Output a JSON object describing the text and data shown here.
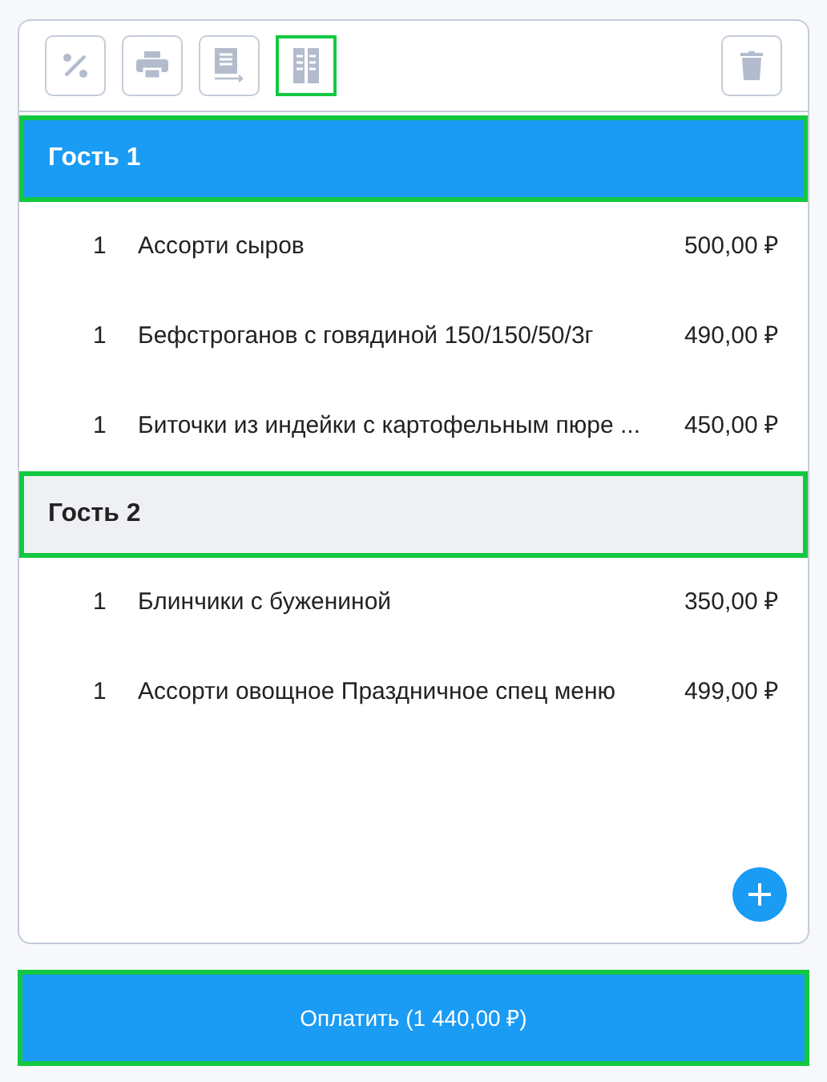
{
  "toolbar": [
    {
      "kind": "percent",
      "highlighted": false
    },
    {
      "kind": "print",
      "highlighted": false
    },
    {
      "kind": "receipt",
      "highlighted": false
    },
    {
      "kind": "split",
      "highlighted": true
    }
  ],
  "guests": [
    {
      "name": "Гость 1",
      "selected": true,
      "items": [
        {
          "qty": "1",
          "name": "Ассорти сыров",
          "price": "500,00 ₽"
        },
        {
          "qty": "1",
          "name": "Бефстроганов с говядиной 150/150/50/3г",
          "price": "490,00 ₽"
        },
        {
          "qty": "1",
          "name": "Биточки из индейки с картофельным пюре ...",
          "price": "450,00 ₽"
        }
      ]
    },
    {
      "name": "Гость 2",
      "selected": false,
      "items": [
        {
          "qty": "1",
          "name": "Блинчики с бужениной",
          "price": "350,00 ₽"
        },
        {
          "qty": "1",
          "name": "Ассорти овощное Праздничное спец меню",
          "price": "499,00 ₽"
        }
      ]
    }
  ],
  "pay_button": "Оплатить (1 440,00 ₽)"
}
